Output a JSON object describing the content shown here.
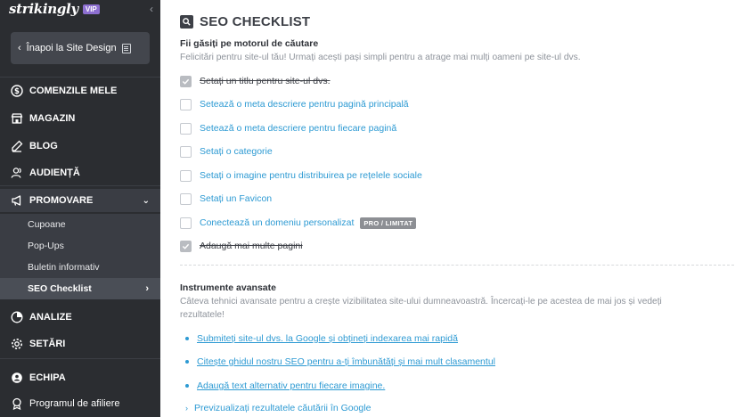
{
  "sidebar": {
    "brand": "strikingly",
    "vip_badge": "VIP",
    "back_label": "Înapoi la Site Design",
    "nav": {
      "orders": "COMENZILE MELE",
      "store": "MAGAZIN",
      "blog": "BLOG",
      "audience": "AUDIENȚĂ",
      "promote": "PROMOVARE",
      "analytics": "ANALIZE",
      "settings": "SETĂRI",
      "team": "ECHIPA"
    },
    "promote_sub": [
      "Cupoane",
      "Pop-Ups",
      "Buletin informativ",
      "SEO Checklist"
    ],
    "affiliate": "Programul de afiliere"
  },
  "main": {
    "title": "SEO CHECKLIST",
    "search": {
      "heading": "Fii găsiți pe motorul de căutare",
      "subtitle": "Felicitări pentru site-ul tău! Urmați acești pași simpli pentru a atrage mai mulți oameni pe site-ul dvs."
    },
    "checklist": [
      {
        "label": "Setați un titlu pentru site-ul dvs.",
        "checked": true
      },
      {
        "label": "Setează o meta descriere pentru pagină principală",
        "checked": false
      },
      {
        "label": "Setează o meta descriere pentru fiecare pagină",
        "checked": false
      },
      {
        "label": "Setați o categorie",
        "checked": false
      },
      {
        "label": "Setați o imagine pentru distribuirea pe rețelele sociale",
        "checked": false
      },
      {
        "label": "Setați un Favicon",
        "checked": false
      },
      {
        "label": "Conectează un domeniu personalizat",
        "checked": false,
        "badge": "PRO / LIMITAT"
      },
      {
        "label": "Adaugă mai multe pagini",
        "checked": true
      }
    ],
    "advanced": {
      "heading": "Instrumente avansate",
      "subtitle_line1": "Câteva tehnici avansate pentru a crește vizibilitatea site-ului dumneavoastră. Încercați-le pe acestea de mai jos și vedeți",
      "subtitle_line2": "rezultatele!",
      "links": [
        "Submiteți site-ul dvs. la Google și obțineți indexarea mai rapidă",
        "Citește ghidul nostru SEO pentru a-ți îmbunătăți și mai mult clasamentul",
        "Adaugă text alternativ pentru fiecare imagine."
      ],
      "preview": "Previzualizați rezultatele căutării în Google"
    }
  }
}
